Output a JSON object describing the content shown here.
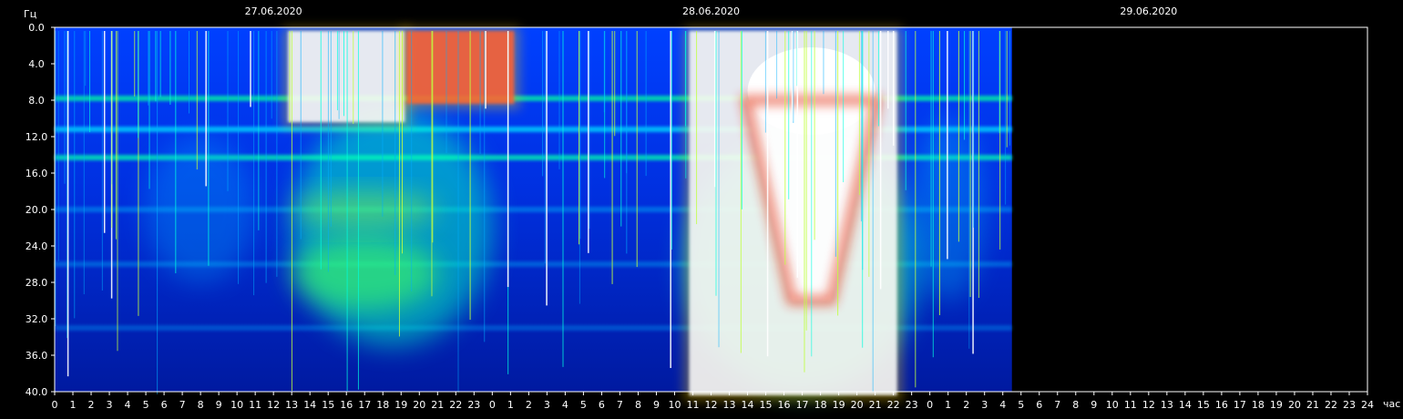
{
  "chart_data": {
    "type": "heatmap",
    "title": "",
    "ylabel": "Гц",
    "xlabel": "час",
    "ylim": [
      0.0,
      40.0
    ],
    "y_ticks": [
      "0.0",
      "4.0",
      "8.0",
      "12.0",
      "16.0",
      "20.0",
      "24.0",
      "28.0",
      "32.0",
      "36.0",
      "40.0"
    ],
    "x_ticks": [
      "0",
      "1",
      "2",
      "3",
      "4",
      "5",
      "6",
      "7",
      "8",
      "9",
      "10",
      "11",
      "12",
      "13",
      "14",
      "15",
      "16",
      "17",
      "18",
      "19",
      "20",
      "21",
      "22",
      "23",
      "0",
      "1",
      "2",
      "3",
      "4",
      "5",
      "6",
      "7",
      "8",
      "9",
      "10",
      "11",
      "12",
      "13",
      "14",
      "15",
      "16",
      "17",
      "18",
      "19",
      "20",
      "21",
      "22",
      "23",
      "0",
      "1",
      "2",
      "3",
      "4",
      "5",
      "6",
      "7",
      "8",
      "9",
      "10",
      "11",
      "12",
      "13",
      "14",
      "15",
      "16",
      "17",
      "18",
      "19",
      "20",
      "21",
      "22",
      "23",
      "24"
    ],
    "dates": [
      {
        "label": "27.06.2020",
        "hour_offset": 12
      },
      {
        "label": "28.06.2020",
        "hour_offset": 36
      },
      {
        "label": "29.06.2020",
        "hour_offset": 60
      }
    ],
    "x_range_hours": [
      0,
      72
    ],
    "data_end_hours": 52.5,
    "colormap": [
      "#000090",
      "#0030ff",
      "#00c8ff",
      "#00ff80",
      "#c8ff00",
      "#ff8000",
      "#c00000",
      "#ffffff"
    ],
    "schumann_bands_hz": [
      7.8,
      11.2,
      14.3,
      20.0,
      26.0,
      33.0
    ],
    "bursts": [
      {
        "start_h": 12.5,
        "end_h": 19.5,
        "fmax_hz": 10,
        "level": "white"
      },
      {
        "start_h": 19.0,
        "end_h": 25.5,
        "fmax_hz": 8,
        "level": "red"
      },
      {
        "start_h": 34.5,
        "end_h": 46.5,
        "fmax_hz": 40,
        "level": "white"
      }
    ]
  }
}
